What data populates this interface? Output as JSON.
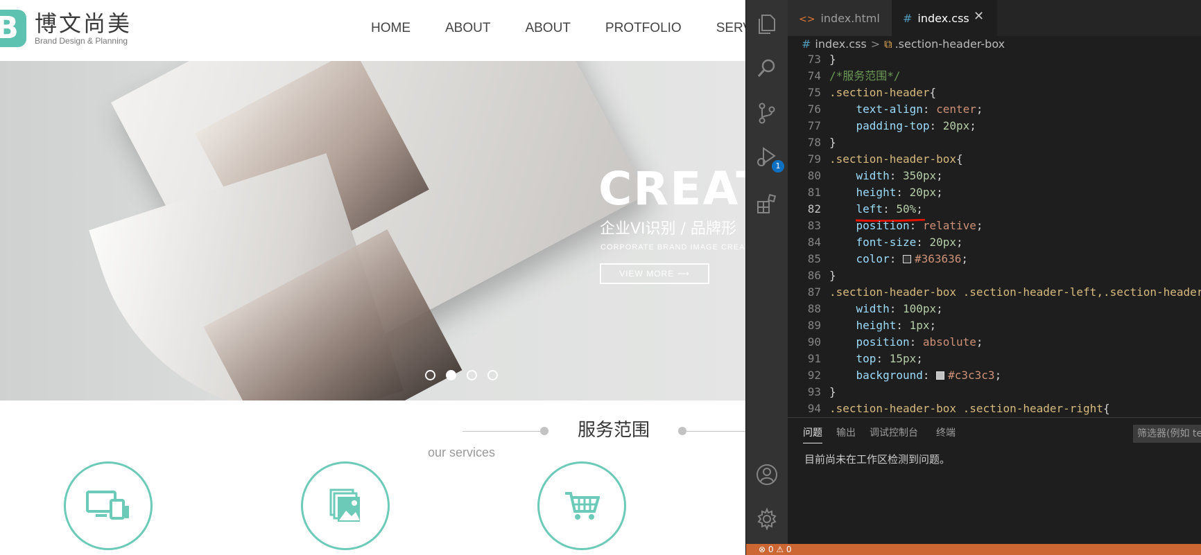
{
  "site": {
    "logo_mark": "B",
    "logo_cn": "博文尚美",
    "logo_en": "Brand Design & Planning",
    "nav": [
      "HOME",
      "ABOUT",
      "ABOUT",
      "PROTFOLIO",
      "SERVICE"
    ],
    "hero": {
      "title": "CREATI",
      "subtitle_cn": "企业VI识别 / 品牌形",
      "subtitle_en": "CORPORATE BRAND IMAGE CREATI",
      "button": "VIEW MORE ⟶"
    },
    "slides": {
      "count": 4,
      "active": 1
    },
    "services": {
      "title": "服务范围",
      "subtitle": "our services",
      "icons": [
        "devices-icon",
        "gallery-icon",
        "cart-icon"
      ]
    }
  },
  "vscode": {
    "tabs": [
      {
        "icon": "<>",
        "label": "index.html"
      },
      {
        "icon": "#",
        "label": "index.css",
        "close": "✕"
      }
    ],
    "breadcrumb": {
      "file": "index.css",
      "separator": ">",
      "symbol": ".section-header-box"
    },
    "debug_badge": "1",
    "code": [
      {
        "n": "73",
        "text": "}"
      },
      {
        "n": "74",
        "text": "/*服务范围*/"
      },
      {
        "n": "75",
        "sel": ".section-header",
        "pun": "{"
      },
      {
        "n": "76",
        "prop": "text-align",
        "value": "center"
      },
      {
        "n": "77",
        "prop": "padding-top",
        "value": "20px"
      },
      {
        "n": "78",
        "text": "}"
      },
      {
        "n": "79",
        "sel": ".section-header-box",
        "pun": "{"
      },
      {
        "n": "80",
        "prop": "width",
        "value": "350px"
      },
      {
        "n": "81",
        "prop": "height",
        "value": "20px"
      },
      {
        "n": "82",
        "prop": "left",
        "value": "50%"
      },
      {
        "n": "83",
        "prop": "position",
        "value": "relative"
      },
      {
        "n": "84",
        "prop": "font-size",
        "value": "20px"
      },
      {
        "n": "85",
        "prop": "color",
        "value": "#363636"
      },
      {
        "n": "86",
        "text": "}"
      },
      {
        "n": "87",
        "sel": ".section-header-box .section-header-left,.section-header-right",
        "pun": ""
      },
      {
        "n": "88",
        "prop": "width",
        "value": "100px"
      },
      {
        "n": "89",
        "prop": "height",
        "value": "1px"
      },
      {
        "n": "90",
        "prop": "position",
        "value": "absolute"
      },
      {
        "n": "91",
        "prop": "top",
        "value": "15px"
      },
      {
        "n": "92",
        "prop": "background",
        "value": "#c3c3c3"
      },
      {
        "n": "93",
        "text": "}"
      },
      {
        "n": "94",
        "sel": ".section-header-box .section-header-right",
        "pun": "{"
      }
    ],
    "current_line": "82",
    "panel": {
      "tabs": [
        "问题",
        "输出",
        "调试控制台",
        "终端"
      ],
      "filter_placeholder": "筛选器(例如 te",
      "message": "目前尚未在工作区检测到问题。"
    },
    "status": "⊗ 0 ⚠ 0"
  },
  "colors": {
    "accent": "#6ccbb8",
    "divider": "#c3c3c3",
    "heading": "#363636",
    "status_bar": "#cc6633",
    "underline": "#e51400"
  }
}
